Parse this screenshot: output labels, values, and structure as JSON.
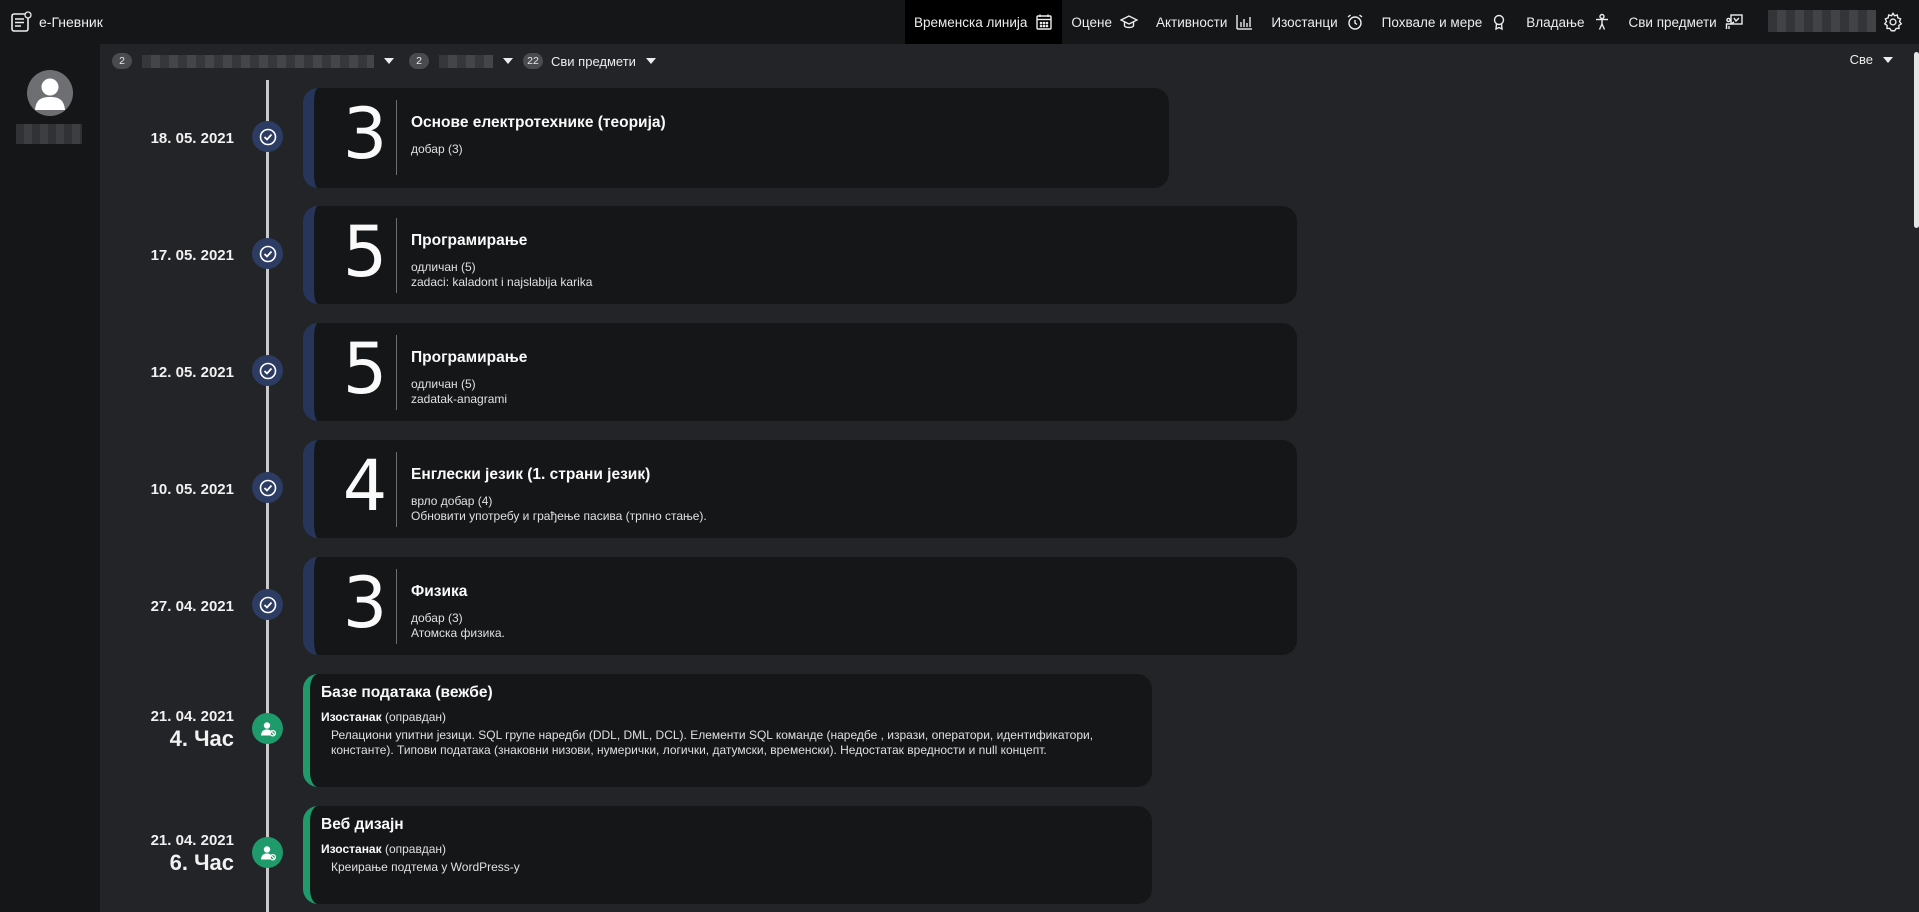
{
  "app": {
    "title": "е-Гневник"
  },
  "nav": [
    {
      "label": "Временска линија",
      "icon": "calendar-icon",
      "active": true
    },
    {
      "label": "Оцене",
      "icon": "graduation-cap-icon",
      "active": false
    },
    {
      "label": "Активности",
      "icon": "bar-chart-icon",
      "active": false
    },
    {
      "label": "Изостанци",
      "icon": "alarm-clock-icon",
      "active": false
    },
    {
      "label": "Похвале и мере",
      "icon": "award-icon",
      "active": false
    },
    {
      "label": "Владање",
      "icon": "person-icon",
      "active": false
    },
    {
      "label": "Сви предмети",
      "icon": "teacher-board-icon",
      "active": false
    }
  ],
  "filters": {
    "student": {
      "badge": "2"
    },
    "class": {
      "badge": "2"
    },
    "subjects": {
      "badge": "22",
      "label": "Сви предмети"
    },
    "type": {
      "label": "Све"
    }
  },
  "timeline": [
    {
      "kind": "grade",
      "date": "18. 05. 2021",
      "grade": "3",
      "subject": "Основе електротехнике (теорија)",
      "lines": [
        "добар (3)"
      ]
    },
    {
      "kind": "grade",
      "date": "17. 05. 2021",
      "grade": "5",
      "subject": "Програмирање",
      "lines": [
        "одличан (5)",
        "zadaci: kaladont i najslabija karika"
      ]
    },
    {
      "kind": "grade",
      "date": "12. 05. 2021",
      "grade": "5",
      "subject": "Програмирање",
      "lines": [
        "одличан (5)",
        "zadatak-anagrami"
      ]
    },
    {
      "kind": "grade",
      "date": "10. 05. 2021",
      "grade": "4",
      "subject": "Енглески језик (1. страни језик)",
      "lines": [
        "врло добар (4)",
        "Обновити употребу и грађење пасива (трпно стање)."
      ]
    },
    {
      "kind": "grade",
      "date": "27. 04. 2021",
      "grade": "3",
      "subject": "Физика",
      "lines": [
        "добар (3)",
        "Атомска физика."
      ]
    },
    {
      "kind": "absence",
      "date": "21. 04. 2021",
      "period": "4. Час",
      "subject": "Базе података (вежбе)",
      "type": "Изостанак",
      "status": "(оправдан)",
      "description": "Релациони упитни језици. SQL групе наредби (DDL, DML, DCL). Елементи SQL команде (наредбе , изрази, оператори, идентификатори, константе). Типови података (знаковни низови, нумерички, логички, датумски, временски). Недостатак вредности и null концепт."
    },
    {
      "kind": "absence",
      "date": "21. 04. 2021",
      "period": "6. Час",
      "subject": "Веб дизајн",
      "type": "Изостанак",
      "status": "(оправдан)",
      "description": "Креирање подтема у WordPress-у"
    }
  ]
}
